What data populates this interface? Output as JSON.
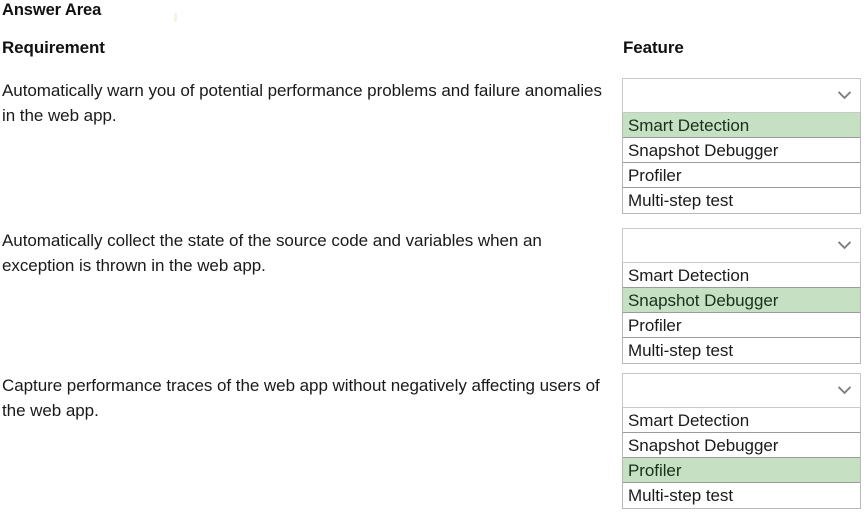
{
  "header": {
    "answer_area_title": "Answer Area",
    "column_requirement": "Requirement",
    "column_feature": "Feature"
  },
  "rows": [
    {
      "requirement": "Automatically warn you of potential performance problems and failure anomalies in the web app.",
      "dropdown": {
        "selected_value": "",
        "icon": "chevron-down-icon",
        "options": [
          {
            "label": "Smart Detection",
            "highlighted": true
          },
          {
            "label": "Snapshot Debugger",
            "highlighted": false
          },
          {
            "label": "Profiler",
            "highlighted": false
          },
          {
            "label": "Multi-step test",
            "highlighted": false
          }
        ]
      }
    },
    {
      "requirement": "Automatically collect the state of the source code and variables when an exception is thrown in the web app.",
      "dropdown": {
        "selected_value": "",
        "icon": "chevron-down-icon",
        "options": [
          {
            "label": "Smart Detection",
            "highlighted": false
          },
          {
            "label": "Snapshot Debugger",
            "highlighted": true
          },
          {
            "label": "Profiler",
            "highlighted": false
          },
          {
            "label": "Multi-step test",
            "highlighted": false
          }
        ]
      }
    },
    {
      "requirement": "Capture performance traces of the web app without negatively affecting users of the web app.",
      "dropdown": {
        "selected_value": "",
        "icon": "chevron-down-icon",
        "options": [
          {
            "label": "Smart Detection",
            "highlighted": false
          },
          {
            "label": "Snapshot Debugger",
            "highlighted": false
          },
          {
            "label": "Profiler",
            "highlighted": true
          },
          {
            "label": "Multi-step test",
            "highlighted": false
          }
        ]
      }
    }
  ],
  "colors": {
    "highlight_green": "#c6e0c4",
    "border_gray": "#9b9b9b",
    "combo_border": "#c8c8c8",
    "text": "#1a1a1a",
    "chevron": "#808080"
  }
}
